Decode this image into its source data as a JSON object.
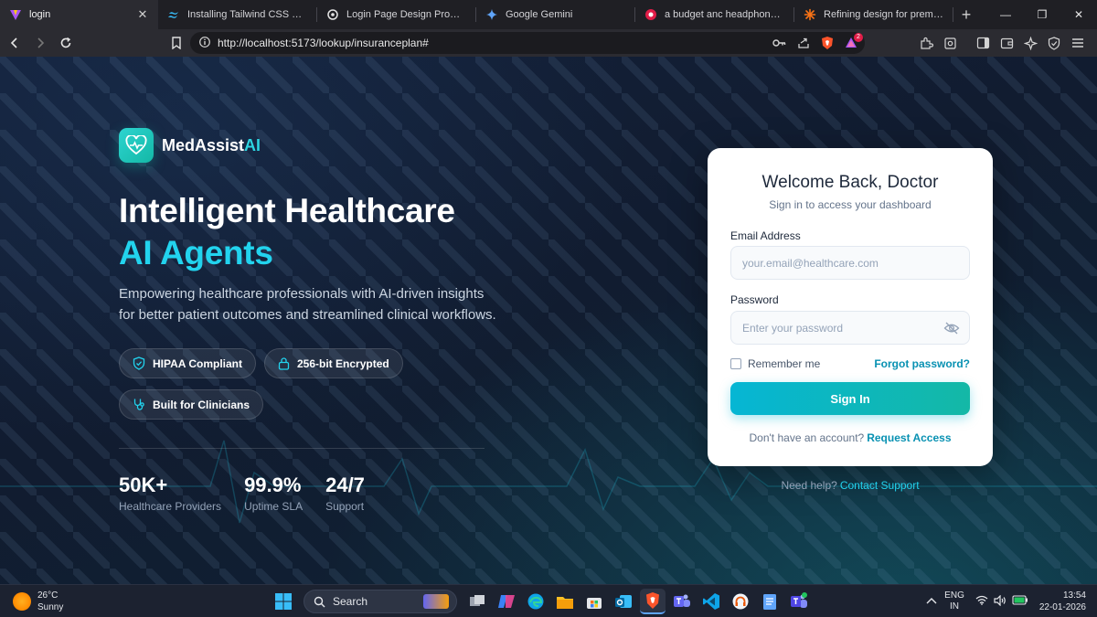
{
  "browser": {
    "tabs": [
      {
        "title": "login",
        "active": true
      },
      {
        "title": "Installing Tailwind CSS with Vite",
        "active": false
      },
      {
        "title": "Login Page Design Prompt",
        "active": false
      },
      {
        "title": "Google Gemini",
        "active": false
      },
      {
        "title": "a budget anc headphone or a g",
        "active": false
      },
      {
        "title": "Refining design for premium res",
        "active": false
      }
    ],
    "url": "http://localhost:5173/lookup/insuranceplan#",
    "shield_badge": "2"
  },
  "brand": {
    "name_main": "MedAssist",
    "name_accent": "AI"
  },
  "hero": {
    "title_line1": "Intelligent Healthcare",
    "title_line2": "AI Agents",
    "description": "Empowering healthcare professionals with AI-driven insights for better patient outcomes and streamlined clinical workflows."
  },
  "badges": [
    {
      "label": "HIPAA Compliant",
      "icon": "shield-check-icon"
    },
    {
      "label": "256-bit Encrypted",
      "icon": "lock-icon"
    },
    {
      "label": "Built for Clinicians",
      "icon": "stethoscope-icon"
    }
  ],
  "stats": [
    {
      "value": "50K+",
      "label": "Healthcare Providers"
    },
    {
      "value": "99.9%",
      "label": "Uptime SLA"
    },
    {
      "value": "24/7",
      "label": "Support"
    }
  ],
  "login": {
    "title": "Welcome Back, Doctor",
    "subtitle": "Sign in to access your dashboard",
    "email_label": "Email Address",
    "email_placeholder": "your.email@healthcare.com",
    "password_label": "Password",
    "password_placeholder": "Enter your password",
    "remember_label": "Remember me",
    "forgot_label": "Forgot password?",
    "signin_label": "Sign In",
    "no_account_text": "Don't have an account?",
    "request_access_label": "Request Access",
    "help_text": "Need help?",
    "contact_support_label": "Contact Support"
  },
  "taskbar": {
    "temperature": "26°C",
    "condition": "Sunny",
    "search_label": "Search",
    "lang_line1": "ENG",
    "lang_line2": "IN",
    "time": "13:54",
    "date": "22-01-2026"
  },
  "colors": {
    "accent": "#22d3ee",
    "button_start": "#06b6d4",
    "button_end": "#14b8a6",
    "link": "#0891b2"
  }
}
